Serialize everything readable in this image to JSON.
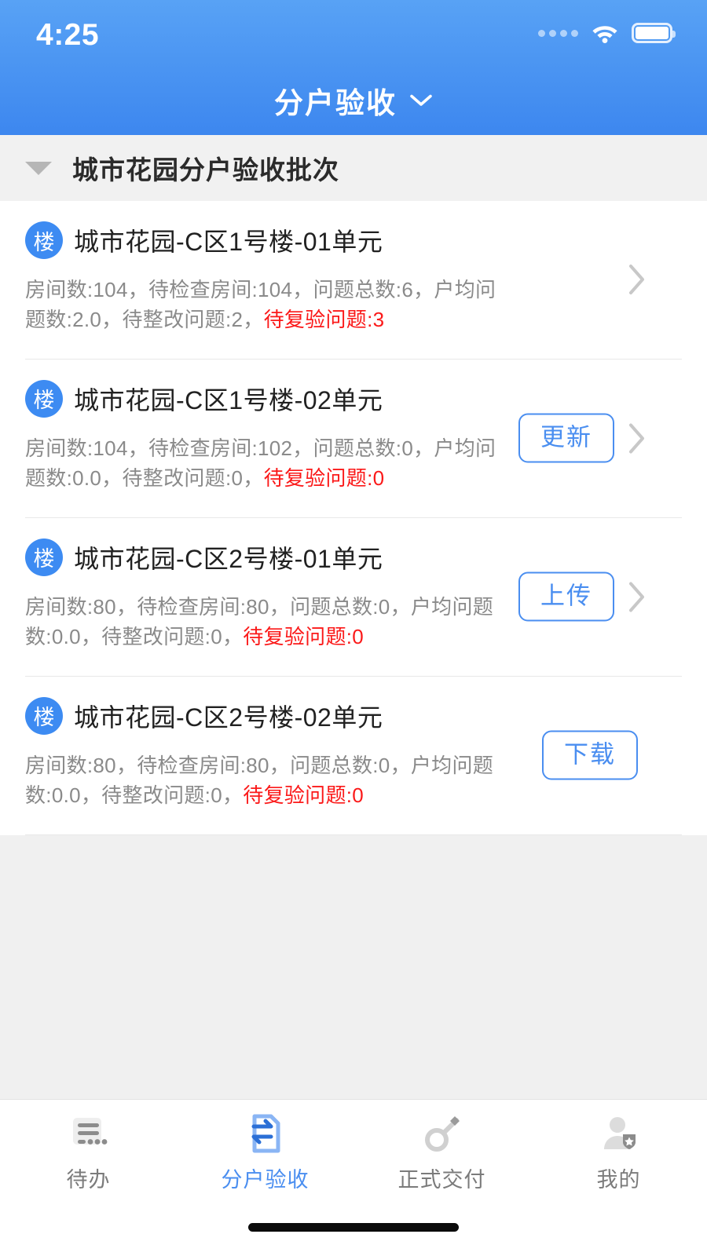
{
  "status_bar": {
    "time": "4:25",
    "signal_icon": "signal-dots-icon",
    "wifi_icon": "wifi-icon",
    "battery_icon": "battery-full-icon"
  },
  "nav": {
    "title": "分户验收",
    "caret_icon": "chevron-down-icon"
  },
  "group": {
    "title": "城市花园分户验收批次",
    "collapse_icon": "triangle-down-icon"
  },
  "colors": {
    "header_top": "#58a2f5",
    "header_bottom": "#3d87ef",
    "accent_blue": "#4a8ef0",
    "badge_blue": "#3d8bf2",
    "warning_red": "#fb1919",
    "meta_gray": "#8a8a8a",
    "page_bg": "#f0f0f0"
  },
  "list": {
    "items": [
      {
        "badge": "楼",
        "name": "城市花园-C区1号楼-01单元",
        "meta_prefix": "房间数:104，待检查房间:104，问题总数:6，户均问题数:2.0，待整改问题:2，",
        "meta_warn": "待复验问题:3",
        "action_label": "",
        "has_action": false,
        "has_chevron": true,
        "chevron_icon": "chevron-right-icon"
      },
      {
        "badge": "楼",
        "name": "城市花园-C区1号楼-02单元",
        "meta_prefix": "房间数:104，待检查房间:102，问题总数:0，户均问题数:0.0，待整改问题:0，",
        "meta_warn": "待复验问题:0",
        "action_label": "更新",
        "has_action": true,
        "has_chevron": true,
        "chevron_icon": "chevron-right-icon"
      },
      {
        "badge": "楼",
        "name": "城市花园-C区2号楼-01单元",
        "meta_prefix": "房间数:80，待检查房间:80，问题总数:0，户均问题数:0.0，待整改问题:0，",
        "meta_warn": "待复验问题:0",
        "action_label": "上传",
        "has_action": true,
        "has_chevron": true,
        "chevron_icon": "chevron-right-icon"
      },
      {
        "badge": "楼",
        "name": "城市花园-C区2号楼-02单元",
        "meta_prefix": "房间数:80，待检查房间:80，问题总数:0，户均问题数:0.0，待整改问题:0，",
        "meta_warn": "待复验问题:0",
        "action_label": "下载",
        "has_action": true,
        "has_chevron": false,
        "chevron_icon": ""
      }
    ]
  },
  "tabbar": {
    "tabs": [
      {
        "label": "待办",
        "icon": "document-lines-icon",
        "active": false
      },
      {
        "label": "分户验收",
        "icon": "document-exchange-icon",
        "active": true
      },
      {
        "label": "正式交付",
        "icon": "key-icon",
        "active": false
      },
      {
        "label": "我的",
        "icon": "user-badge-icon",
        "active": false
      }
    ]
  }
}
